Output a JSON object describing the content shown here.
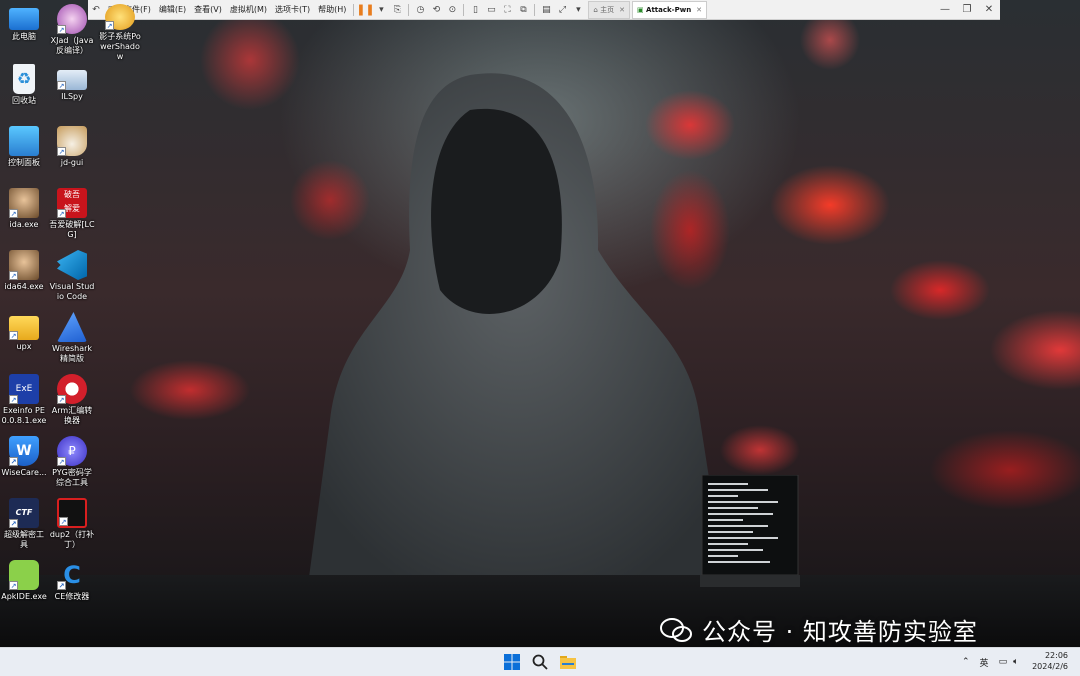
{
  "vm": {
    "menus": [
      "文件(F)",
      "编辑(E)",
      "查看(V)",
      "虚拟机(M)",
      "选项卡(T)",
      "帮助(H)"
    ],
    "tabs": [
      {
        "label": "主页",
        "active": false
      },
      {
        "label": "Attack-Pwn",
        "active": true
      }
    ]
  },
  "desktop": {
    "icons": [
      {
        "label": "此电脑",
        "icon": "computer-icon"
      },
      {
        "label": "回收站",
        "icon": "recycle-bin-icon"
      },
      {
        "label": "控制面板",
        "icon": "control-panel-icon"
      },
      {
        "label": "ida.exe",
        "icon": "ida-icon"
      },
      {
        "label": "ida64.exe",
        "icon": "ida64-icon"
      },
      {
        "label": "upx",
        "icon": "folder-icon"
      },
      {
        "label": "Exeinfo PE 0.0.8.1.exe",
        "icon": "exeinfo-icon"
      },
      {
        "label": "WiseCare...",
        "icon": "wisecare-icon"
      },
      {
        "label": "超级解密工具",
        "icon": "ctf-icon"
      },
      {
        "label": "ApkIDE.exe",
        "icon": "android-icon"
      },
      {
        "label": "XJad（Java反编译）",
        "icon": "xjad-icon"
      },
      {
        "label": "ILSpy",
        "icon": "ilspy-icon"
      },
      {
        "label": "jd-gui",
        "icon": "jd-gui-icon"
      },
      {
        "label": "吾爱破解[LCG]",
        "icon": "52pojie-icon"
      },
      {
        "label": "Visual Studio Code",
        "icon": "vscode-icon"
      },
      {
        "label": "Wireshark精简版",
        "icon": "wireshark-icon"
      },
      {
        "label": "Arm汇编转换器",
        "icon": "arm-converter-icon"
      },
      {
        "label": "PYG密码学综合工具",
        "icon": "pyg-icon"
      },
      {
        "label": "dup2（打补丁）",
        "icon": "dup2-icon"
      },
      {
        "label": "CE修改器",
        "icon": "cheat-engine-icon"
      },
      {
        "label": "影子系统PowerShadow",
        "icon": "powershadow-icon"
      }
    ]
  },
  "watermark": {
    "text": "公众号 · 知攻善防实验室"
  },
  "taskbar": {
    "lang": "英",
    "time": "22:06",
    "date": "2024/2/6",
    "icons": [
      "windows-start-icon",
      "search-icon",
      "file-explorer-icon"
    ]
  },
  "colors": {
    "accent": "#e87d1e",
    "taskbar": "#e9edf3",
    "wallpaper_glow": "#ff3c2a"
  }
}
